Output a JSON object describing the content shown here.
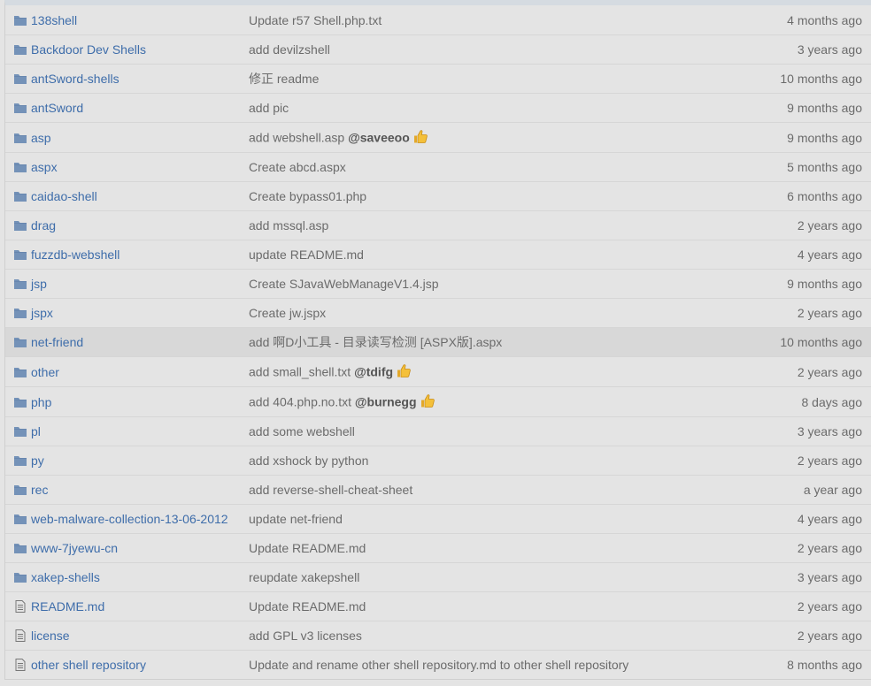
{
  "colors": {
    "link": "#3e6daa",
    "text": "#6b6b6b",
    "folder": "#7492b8",
    "row_highlight": "#d8d8d8"
  },
  "rows": [
    {
      "type": "folder",
      "name": "138shell",
      "message": "Update r57 Shell.php.txt",
      "mention": "",
      "thumb": false,
      "age": "4 months ago"
    },
    {
      "type": "folder",
      "name": "Backdoor Dev Shells",
      "message": "add devilzshell",
      "mention": "",
      "thumb": false,
      "age": "3 years ago"
    },
    {
      "type": "folder",
      "name": "antSword-shells",
      "message": "修正 readme",
      "mention": "",
      "thumb": false,
      "age": "10 months ago"
    },
    {
      "type": "folder",
      "name": "antSword",
      "message": "add pic",
      "mention": "",
      "thumb": false,
      "age": "9 months ago"
    },
    {
      "type": "folder",
      "name": "asp",
      "message": "add webshell.asp ",
      "mention": "@saveeoo",
      "thumb": true,
      "age": "9 months ago"
    },
    {
      "type": "folder",
      "name": "aspx",
      "message": "Create abcd.aspx",
      "mention": "",
      "thumb": false,
      "age": "5 months ago"
    },
    {
      "type": "folder",
      "name": "caidao-shell",
      "message": "Create bypass01.php",
      "mention": "",
      "thumb": false,
      "age": "6 months ago"
    },
    {
      "type": "folder",
      "name": "drag",
      "message": "add mssql.asp",
      "mention": "",
      "thumb": false,
      "age": "2 years ago"
    },
    {
      "type": "folder",
      "name": "fuzzdb-webshell",
      "message": "update README.md",
      "mention": "",
      "thumb": false,
      "age": "4 years ago"
    },
    {
      "type": "folder",
      "name": "jsp",
      "message": "Create SJavaWebManageV1.4.jsp",
      "mention": "",
      "thumb": false,
      "age": "9 months ago"
    },
    {
      "type": "folder",
      "name": "jspx",
      "message": "Create jw.jspx",
      "mention": "",
      "thumb": false,
      "age": "2 years ago"
    },
    {
      "type": "folder",
      "name": "net-friend",
      "message": "add 啊D小工具 - 目录读写检测 [ASPX版].aspx",
      "mention": "",
      "thumb": false,
      "age": "10 months ago",
      "highlight": true
    },
    {
      "type": "folder",
      "name": "other",
      "message": "add small_shell.txt ",
      "mention": "@tdifg",
      "thumb": true,
      "age": "2 years ago"
    },
    {
      "type": "folder",
      "name": "php",
      "message": "add 404.php.no.txt ",
      "mention": "@burnegg",
      "thumb": true,
      "age": "8 days ago"
    },
    {
      "type": "folder",
      "name": "pl",
      "message": "add some webshell",
      "mention": "",
      "thumb": false,
      "age": "3 years ago"
    },
    {
      "type": "folder",
      "name": "py",
      "message": "add xshock by python",
      "mention": "",
      "thumb": false,
      "age": "2 years ago"
    },
    {
      "type": "folder",
      "name": "rec",
      "message": "add reverse-shell-cheat-sheet",
      "mention": "",
      "thumb": false,
      "age": "a year ago"
    },
    {
      "type": "folder",
      "name": "web-malware-collection-13-06-2012",
      "message": "update net-friend",
      "mention": "",
      "thumb": false,
      "age": "4 years ago"
    },
    {
      "type": "folder",
      "name": "www-7jyewu-cn",
      "message": "Update README.md",
      "mention": "",
      "thumb": false,
      "age": "2 years ago"
    },
    {
      "type": "folder",
      "name": "xakep-shells",
      "message": "reupdate xakepshell",
      "mention": "",
      "thumb": false,
      "age": "3 years ago"
    },
    {
      "type": "file",
      "name": "README.md",
      "message": "Update README.md",
      "mention": "",
      "thumb": false,
      "age": "2 years ago"
    },
    {
      "type": "file",
      "name": "license",
      "message": "add GPL v3 licenses",
      "mention": "",
      "thumb": false,
      "age": "2 years ago"
    },
    {
      "type": "file",
      "name": "other shell repository",
      "message": "Update and rename other shell repository.md to other shell repository",
      "mention": "",
      "thumb": false,
      "age": "8 months ago"
    }
  ]
}
